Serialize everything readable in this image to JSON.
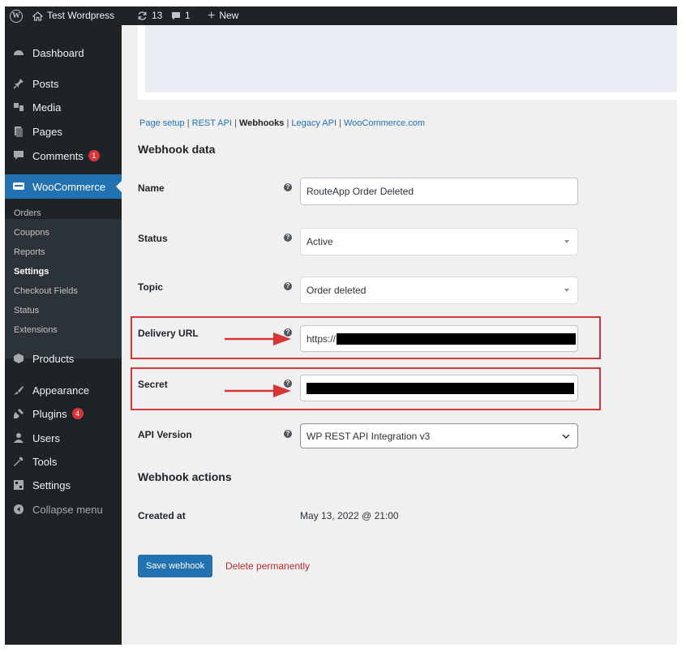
{
  "admin_bar": {
    "site_name": "Test Wordpress",
    "updates_count": "13",
    "comments_count": "1",
    "new_label": "New"
  },
  "sidebar": {
    "items": [
      {
        "label": "Dashboard",
        "icon": "dashboard-icon"
      },
      {
        "label": "Posts",
        "icon": "pin-icon"
      },
      {
        "label": "Media",
        "icon": "media-icon"
      },
      {
        "label": "Pages",
        "icon": "pages-icon"
      },
      {
        "label": "Comments",
        "icon": "comment-icon",
        "badge": "1"
      },
      {
        "label": "WooCommerce",
        "icon": "woo-icon",
        "current": true
      },
      {
        "label": "Products",
        "icon": "products-icon"
      },
      {
        "label": "Appearance",
        "icon": "appearance-icon"
      },
      {
        "label": "Plugins",
        "icon": "plugins-icon",
        "badge": "4"
      },
      {
        "label": "Users",
        "icon": "users-icon"
      },
      {
        "label": "Tools",
        "icon": "tools-icon"
      },
      {
        "label": "Settings",
        "icon": "settings-icon"
      },
      {
        "label": "Collapse menu",
        "icon": "collapse-icon"
      }
    ],
    "woocommerce_submenu": [
      "Orders",
      "Coupons",
      "Reports",
      "Settings",
      "Checkout Fields",
      "Status",
      "Extensions"
    ]
  },
  "subsubsub": {
    "links": [
      "Page setup",
      "REST API",
      "Webhooks",
      "Legacy API",
      "WooCommerce.com"
    ],
    "current": "Webhooks"
  },
  "webhook_data": {
    "heading": "Webhook data",
    "name_label": "Name",
    "name_value": "RouteApp Order Deleted",
    "status_label": "Status",
    "status_value": "Active",
    "topic_label": "Topic",
    "topic_value": "Order deleted",
    "delivery_url_label": "Delivery URL",
    "delivery_url_value": "https://",
    "secret_label": "Secret",
    "api_version_label": "API Version",
    "api_version_value": "WP REST API Integration v3"
  },
  "webhook_actions": {
    "heading": "Webhook actions",
    "created_label": "Created at",
    "created_value": "May 13, 2022 @ 21:00",
    "save_label": "Save webhook",
    "delete_label": "Delete permanently"
  },
  "colors": {
    "accent": "#2271b1",
    "highlight": "#d63638",
    "sidebar": "#1d2327"
  }
}
